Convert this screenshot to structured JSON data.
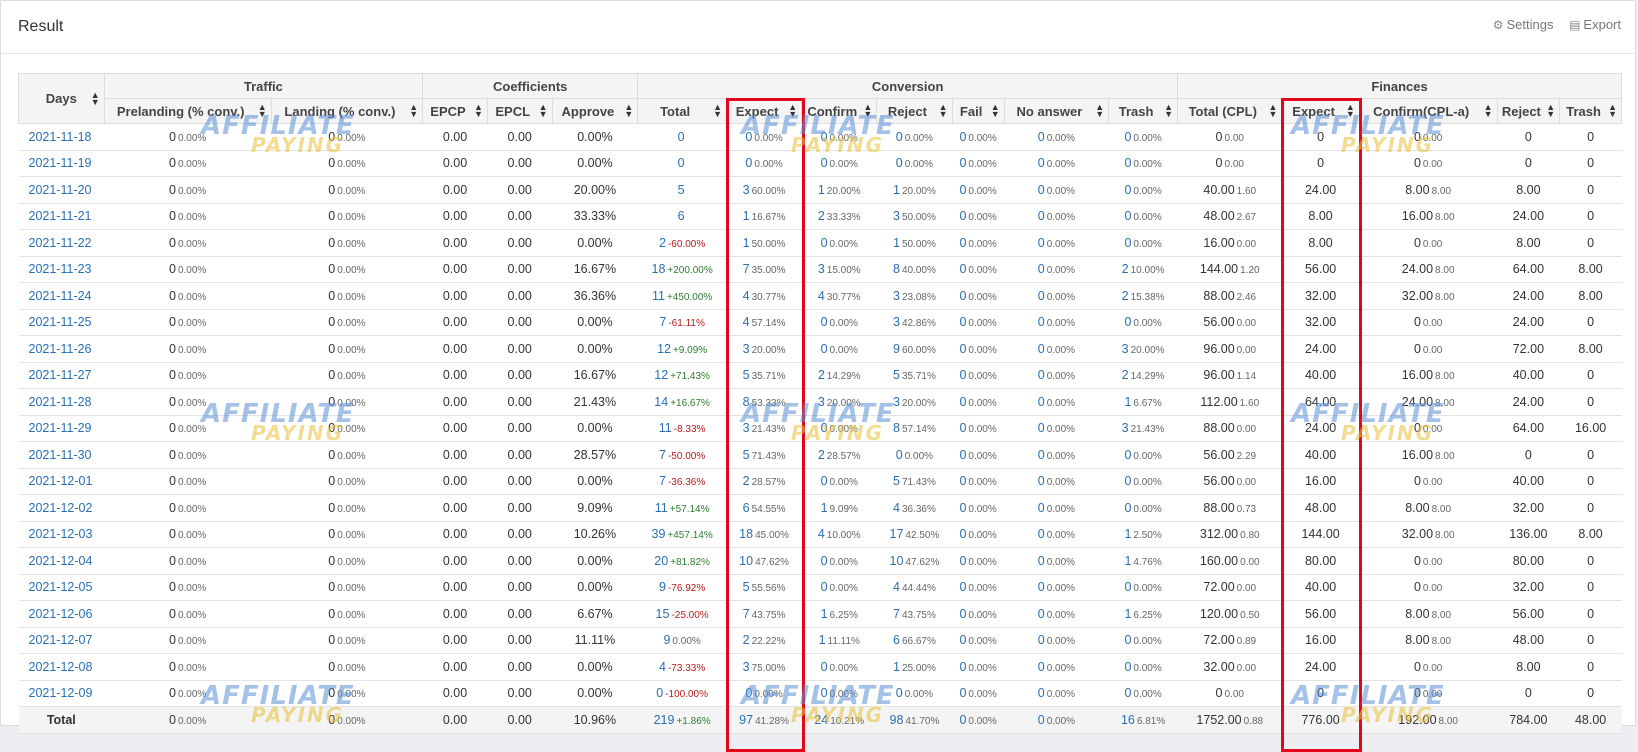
{
  "panel": {
    "title": "Result",
    "settings_label": "Settings",
    "export_label": "Export",
    "settings_icon": "gear-icon",
    "export_icon": "file-icon"
  },
  "watermark": {
    "line1": "AFFILIATE",
    "line2": "PAYING"
  },
  "headers": {
    "days": "Days",
    "groups": [
      "Traffic",
      "Coefficients",
      "Conversion",
      "Finances"
    ],
    "columns": [
      "Prelanding (% conv.)",
      "Landing (% conv.)",
      "EPCP",
      "EPCL",
      "Approve",
      "Total",
      "Expect",
      "Confirm",
      "Reject",
      "Fail",
      "No answer",
      "Trash",
      "Total (CPL)",
      "Expect",
      "Confirm(CPL-a)",
      "Reject",
      "Trash"
    ]
  },
  "rows": [
    {
      "date": "2021-11-18",
      "pre": "0",
      "pre_p": "0.00%",
      "land": "0",
      "land_p": "0.00%",
      "epcp": "0.00",
      "epcl": "0.00",
      "approve": "0.00%",
      "total": "0",
      "total_p": "",
      "total_s": "",
      "expect": "0",
      "expect_p": "0.00%",
      "confirm": "0",
      "confirm_p": "0.00%",
      "reject": "0",
      "reject_p": "0.00%",
      "fail": "0",
      "fail_p": "0.00%",
      "noans": "0",
      "noans_p": "0.00%",
      "trash": "0",
      "trash_p": "0.00%",
      "fcpl": "0",
      "fcpl_s": "0.00",
      "fexpect": "0",
      "fconfirm": "0",
      "fconfirm_s": "0.00",
      "freject": "0",
      "ftrash": "0"
    },
    {
      "date": "2021-11-19",
      "pre": "0",
      "pre_p": "0.00%",
      "land": "0",
      "land_p": "0.00%",
      "epcp": "0.00",
      "epcl": "0.00",
      "approve": "0.00%",
      "total": "0",
      "total_p": "",
      "total_s": "",
      "expect": "0",
      "expect_p": "0.00%",
      "confirm": "0",
      "confirm_p": "0.00%",
      "reject": "0",
      "reject_p": "0.00%",
      "fail": "0",
      "fail_p": "0.00%",
      "noans": "0",
      "noans_p": "0.00%",
      "trash": "0",
      "trash_p": "0.00%",
      "fcpl": "0",
      "fcpl_s": "0.00",
      "fexpect": "0",
      "fconfirm": "0",
      "fconfirm_s": "0.00",
      "freject": "0",
      "ftrash": "0"
    },
    {
      "date": "2021-11-20",
      "pre": "0",
      "pre_p": "0.00%",
      "land": "0",
      "land_p": "0.00%",
      "epcp": "0.00",
      "epcl": "0.00",
      "approve": "20.00%",
      "total": "5",
      "total_p": "",
      "total_s": "",
      "expect": "3",
      "expect_p": "60.00%",
      "confirm": "1",
      "confirm_p": "20.00%",
      "reject": "1",
      "reject_p": "20.00%",
      "fail": "0",
      "fail_p": "0.00%",
      "noans": "0",
      "noans_p": "0.00%",
      "trash": "0",
      "trash_p": "0.00%",
      "fcpl": "40.00",
      "fcpl_s": "1.60",
      "fexpect": "24.00",
      "fconfirm": "8.00",
      "fconfirm_s": "8.00",
      "freject": "8.00",
      "ftrash": "0"
    },
    {
      "date": "2021-11-21",
      "pre": "0",
      "pre_p": "0.00%",
      "land": "0",
      "land_p": "0.00%",
      "epcp": "0.00",
      "epcl": "0.00",
      "approve": "33.33%",
      "total": "6",
      "total_p": "",
      "total_s": "",
      "expect": "1",
      "expect_p": "16.67%",
      "confirm": "2",
      "confirm_p": "33.33%",
      "reject": "3",
      "reject_p": "50.00%",
      "fail": "0",
      "fail_p": "0.00%",
      "noans": "0",
      "noans_p": "0.00%",
      "trash": "0",
      "trash_p": "0.00%",
      "fcpl": "48.00",
      "fcpl_s": "2.67",
      "fexpect": "8.00",
      "fconfirm": "16.00",
      "fconfirm_s": "8.00",
      "freject": "24.00",
      "ftrash": "0"
    },
    {
      "date": "2021-11-22",
      "pre": "0",
      "pre_p": "0.00%",
      "land": "0",
      "land_p": "0.00%",
      "epcp": "0.00",
      "epcl": "0.00",
      "approve": "0.00%",
      "total": "2",
      "total_p": "-60.00%",
      "total_s": "neg",
      "expect": "1",
      "expect_p": "50.00%",
      "confirm": "0",
      "confirm_p": "0.00%",
      "reject": "1",
      "reject_p": "50.00%",
      "fail": "0",
      "fail_p": "0.00%",
      "noans": "0",
      "noans_p": "0.00%",
      "trash": "0",
      "trash_p": "0.00%",
      "fcpl": "16.00",
      "fcpl_s": "0.00",
      "fexpect": "8.00",
      "fconfirm": "0",
      "fconfirm_s": "0.00",
      "freject": "8.00",
      "ftrash": "0"
    },
    {
      "date": "2021-11-23",
      "pre": "0",
      "pre_p": "0.00%",
      "land": "0",
      "land_p": "0.00%",
      "epcp": "0.00",
      "epcl": "0.00",
      "approve": "16.67%",
      "total": "18",
      "total_p": "+200.00%",
      "total_s": "pos",
      "expect": "7",
      "expect_p": "35.00%",
      "confirm": "3",
      "confirm_p": "15.00%",
      "reject": "8",
      "reject_p": "40.00%",
      "fail": "0",
      "fail_p": "0.00%",
      "noans": "0",
      "noans_p": "0.00%",
      "trash": "2",
      "trash_p": "10.00%",
      "fcpl": "144.00",
      "fcpl_s": "1.20",
      "fexpect": "56.00",
      "fconfirm": "24.00",
      "fconfirm_s": "8.00",
      "freject": "64.00",
      "ftrash": "8.00"
    },
    {
      "date": "2021-11-24",
      "pre": "0",
      "pre_p": "0.00%",
      "land": "0",
      "land_p": "0.00%",
      "epcp": "0.00",
      "epcl": "0.00",
      "approve": "36.36%",
      "total": "11",
      "total_p": "+450.00%",
      "total_s": "pos",
      "expect": "4",
      "expect_p": "30.77%",
      "confirm": "4",
      "confirm_p": "30.77%",
      "reject": "3",
      "reject_p": "23.08%",
      "fail": "0",
      "fail_p": "0.00%",
      "noans": "0",
      "noans_p": "0.00%",
      "trash": "2",
      "trash_p": "15.38%",
      "fcpl": "88.00",
      "fcpl_s": "2.46",
      "fexpect": "32.00",
      "fconfirm": "32.00",
      "fconfirm_s": "8.00",
      "freject": "24.00",
      "ftrash": "8.00"
    },
    {
      "date": "2021-11-25",
      "pre": "0",
      "pre_p": "0.00%",
      "land": "0",
      "land_p": "0.00%",
      "epcp": "0.00",
      "epcl": "0.00",
      "approve": "0.00%",
      "total": "7",
      "total_p": "-61.11%",
      "total_s": "neg",
      "expect": "4",
      "expect_p": "57.14%",
      "confirm": "0",
      "confirm_p": "0.00%",
      "reject": "3",
      "reject_p": "42.86%",
      "fail": "0",
      "fail_p": "0.00%",
      "noans": "0",
      "noans_p": "0.00%",
      "trash": "0",
      "trash_p": "0.00%",
      "fcpl": "56.00",
      "fcpl_s": "0.00",
      "fexpect": "32.00",
      "fconfirm": "0",
      "fconfirm_s": "0.00",
      "freject": "24.00",
      "ftrash": "0"
    },
    {
      "date": "2021-11-26",
      "pre": "0",
      "pre_p": "0.00%",
      "land": "0",
      "land_p": "0.00%",
      "epcp": "0.00",
      "epcl": "0.00",
      "approve": "0.00%",
      "total": "12",
      "total_p": "+9.09%",
      "total_s": "pos",
      "expect": "3",
      "expect_p": "20.00%",
      "confirm": "0",
      "confirm_p": "0.00%",
      "reject": "9",
      "reject_p": "60.00%",
      "fail": "0",
      "fail_p": "0.00%",
      "noans": "0",
      "noans_p": "0.00%",
      "trash": "3",
      "trash_p": "20.00%",
      "fcpl": "96.00",
      "fcpl_s": "0.00",
      "fexpect": "24.00",
      "fconfirm": "0",
      "fconfirm_s": "0.00",
      "freject": "72.00",
      "ftrash": "8.00"
    },
    {
      "date": "2021-11-27",
      "pre": "0",
      "pre_p": "0.00%",
      "land": "0",
      "land_p": "0.00%",
      "epcp": "0.00",
      "epcl": "0.00",
      "approve": "16.67%",
      "total": "12",
      "total_p": "+71.43%",
      "total_s": "pos",
      "expect": "5",
      "expect_p": "35.71%",
      "confirm": "2",
      "confirm_p": "14.29%",
      "reject": "5",
      "reject_p": "35.71%",
      "fail": "0",
      "fail_p": "0.00%",
      "noans": "0",
      "noans_p": "0.00%",
      "trash": "2",
      "trash_p": "14.29%",
      "fcpl": "96.00",
      "fcpl_s": "1.14",
      "fexpect": "40.00",
      "fconfirm": "16.00",
      "fconfirm_s": "8.00",
      "freject": "40.00",
      "ftrash": "0"
    },
    {
      "date": "2021-11-28",
      "pre": "0",
      "pre_p": "0.00%",
      "land": "0",
      "land_p": "0.00%",
      "epcp": "0.00",
      "epcl": "0.00",
      "approve": "21.43%",
      "total": "14",
      "total_p": "+16.67%",
      "total_s": "pos",
      "expect": "8",
      "expect_p": "53.33%",
      "confirm": "3",
      "confirm_p": "20.00%",
      "reject": "3",
      "reject_p": "20.00%",
      "fail": "0",
      "fail_p": "0.00%",
      "noans": "0",
      "noans_p": "0.00%",
      "trash": "1",
      "trash_p": "6.67%",
      "fcpl": "112.00",
      "fcpl_s": "1.60",
      "fexpect": "64.00",
      "fconfirm": "24.00",
      "fconfirm_s": "8.00",
      "freject": "24.00",
      "ftrash": "0"
    },
    {
      "date": "2021-11-29",
      "pre": "0",
      "pre_p": "0.00%",
      "land": "0",
      "land_p": "0.00%",
      "epcp": "0.00",
      "epcl": "0.00",
      "approve": "0.00%",
      "total": "11",
      "total_p": "-8.33%",
      "total_s": "neg",
      "expect": "3",
      "expect_p": "21.43%",
      "confirm": "0",
      "confirm_p": "0.00%",
      "reject": "8",
      "reject_p": "57.14%",
      "fail": "0",
      "fail_p": "0.00%",
      "noans": "0",
      "noans_p": "0.00%",
      "trash": "3",
      "trash_p": "21.43%",
      "fcpl": "88.00",
      "fcpl_s": "0.00",
      "fexpect": "24.00",
      "fconfirm": "0",
      "fconfirm_s": "0.00",
      "freject": "64.00",
      "ftrash": "16.00"
    },
    {
      "date": "2021-11-30",
      "pre": "0",
      "pre_p": "0.00%",
      "land": "0",
      "land_p": "0.00%",
      "epcp": "0.00",
      "epcl": "0.00",
      "approve": "28.57%",
      "total": "7",
      "total_p": "-50.00%",
      "total_s": "neg",
      "expect": "5",
      "expect_p": "71.43%",
      "confirm": "2",
      "confirm_p": "28.57%",
      "reject": "0",
      "reject_p": "0.00%",
      "fail": "0",
      "fail_p": "0.00%",
      "noans": "0",
      "noans_p": "0.00%",
      "trash": "0",
      "trash_p": "0.00%",
      "fcpl": "56.00",
      "fcpl_s": "2.29",
      "fexpect": "40.00",
      "fconfirm": "16.00",
      "fconfirm_s": "8.00",
      "freject": "0",
      "ftrash": "0"
    },
    {
      "date": "2021-12-01",
      "pre": "0",
      "pre_p": "0.00%",
      "land": "0",
      "land_p": "0.00%",
      "epcp": "0.00",
      "epcl": "0.00",
      "approve": "0.00%",
      "total": "7",
      "total_p": "-36.36%",
      "total_s": "neg",
      "expect": "2",
      "expect_p": "28.57%",
      "confirm": "0",
      "confirm_p": "0.00%",
      "reject": "5",
      "reject_p": "71.43%",
      "fail": "0",
      "fail_p": "0.00%",
      "noans": "0",
      "noans_p": "0.00%",
      "trash": "0",
      "trash_p": "0.00%",
      "fcpl": "56.00",
      "fcpl_s": "0.00",
      "fexpect": "16.00",
      "fconfirm": "0",
      "fconfirm_s": "0.00",
      "freject": "40.00",
      "ftrash": "0"
    },
    {
      "date": "2021-12-02",
      "pre": "0",
      "pre_p": "0.00%",
      "land": "0",
      "land_p": "0.00%",
      "epcp": "0.00",
      "epcl": "0.00",
      "approve": "9.09%",
      "total": "11",
      "total_p": "+57.14%",
      "total_s": "pos",
      "expect": "6",
      "expect_p": "54.55%",
      "confirm": "1",
      "confirm_p": "9.09%",
      "reject": "4",
      "reject_p": "36.36%",
      "fail": "0",
      "fail_p": "0.00%",
      "noans": "0",
      "noans_p": "0.00%",
      "trash": "0",
      "trash_p": "0.00%",
      "fcpl": "88.00",
      "fcpl_s": "0.73",
      "fexpect": "48.00",
      "fconfirm": "8.00",
      "fconfirm_s": "8.00",
      "freject": "32.00",
      "ftrash": "0"
    },
    {
      "date": "2021-12-03",
      "pre": "0",
      "pre_p": "0.00%",
      "land": "0",
      "land_p": "0.00%",
      "epcp": "0.00",
      "epcl": "0.00",
      "approve": "10.26%",
      "total": "39",
      "total_p": "+457.14%",
      "total_s": "pos",
      "expect": "18",
      "expect_p": "45.00%",
      "confirm": "4",
      "confirm_p": "10.00%",
      "reject": "17",
      "reject_p": "42.50%",
      "fail": "0",
      "fail_p": "0.00%",
      "noans": "0",
      "noans_p": "0.00%",
      "trash": "1",
      "trash_p": "2.50%",
      "fcpl": "312.00",
      "fcpl_s": "0.80",
      "fexpect": "144.00",
      "fconfirm": "32.00",
      "fconfirm_s": "8.00",
      "freject": "136.00",
      "ftrash": "8.00"
    },
    {
      "date": "2021-12-04",
      "pre": "0",
      "pre_p": "0.00%",
      "land": "0",
      "land_p": "0.00%",
      "epcp": "0.00",
      "epcl": "0.00",
      "approve": "0.00%",
      "total": "20",
      "total_p": "+81.82%",
      "total_s": "pos",
      "expect": "10",
      "expect_p": "47.62%",
      "confirm": "0",
      "confirm_p": "0.00%",
      "reject": "10",
      "reject_p": "47.62%",
      "fail": "0",
      "fail_p": "0.00%",
      "noans": "0",
      "noans_p": "0.00%",
      "trash": "1",
      "trash_p": "4.76%",
      "fcpl": "160.00",
      "fcpl_s": "0.00",
      "fexpect": "80.00",
      "fconfirm": "0",
      "fconfirm_s": "0.00",
      "freject": "80.00",
      "ftrash": "0"
    },
    {
      "date": "2021-12-05",
      "pre": "0",
      "pre_p": "0.00%",
      "land": "0",
      "land_p": "0.00%",
      "epcp": "0.00",
      "epcl": "0.00",
      "approve": "0.00%",
      "total": "9",
      "total_p": "-76.92%",
      "total_s": "neg",
      "expect": "5",
      "expect_p": "55.56%",
      "confirm": "0",
      "confirm_p": "0.00%",
      "reject": "4",
      "reject_p": "44.44%",
      "fail": "0",
      "fail_p": "0.00%",
      "noans": "0",
      "noans_p": "0.00%",
      "trash": "0",
      "trash_p": "0.00%",
      "fcpl": "72.00",
      "fcpl_s": "0.00",
      "fexpect": "40.00",
      "fconfirm": "0",
      "fconfirm_s": "0.00",
      "freject": "32.00",
      "ftrash": "0"
    },
    {
      "date": "2021-12-06",
      "pre": "0",
      "pre_p": "0.00%",
      "land": "0",
      "land_p": "0.00%",
      "epcp": "0.00",
      "epcl": "0.00",
      "approve": "6.67%",
      "total": "15",
      "total_p": "-25.00%",
      "total_s": "neg",
      "expect": "7",
      "expect_p": "43.75%",
      "confirm": "1",
      "confirm_p": "6.25%",
      "reject": "7",
      "reject_p": "43.75%",
      "fail": "0",
      "fail_p": "0.00%",
      "noans": "0",
      "noans_p": "0.00%",
      "trash": "1",
      "trash_p": "6.25%",
      "fcpl": "120.00",
      "fcpl_s": "0.50",
      "fexpect": "56.00",
      "fconfirm": "8.00",
      "fconfirm_s": "8.00",
      "freject": "56.00",
      "ftrash": "0"
    },
    {
      "date": "2021-12-07",
      "pre": "0",
      "pre_p": "0.00%",
      "land": "0",
      "land_p": "0.00%",
      "epcp": "0.00",
      "epcl": "0.00",
      "approve": "11.11%",
      "total": "9",
      "total_p": "0.00%",
      "total_s": "small",
      "expect": "2",
      "expect_p": "22.22%",
      "confirm": "1",
      "confirm_p": "11.11%",
      "reject": "6",
      "reject_p": "66.67%",
      "fail": "0",
      "fail_p": "0.00%",
      "noans": "0",
      "noans_p": "0.00%",
      "trash": "0",
      "trash_p": "0.00%",
      "fcpl": "72.00",
      "fcpl_s": "0.89",
      "fexpect": "16.00",
      "fconfirm": "8.00",
      "fconfirm_s": "8.00",
      "freject": "48.00",
      "ftrash": "0"
    },
    {
      "date": "2021-12-08",
      "pre": "0",
      "pre_p": "0.00%",
      "land": "0",
      "land_p": "0.00%",
      "epcp": "0.00",
      "epcl": "0.00",
      "approve": "0.00%",
      "total": "4",
      "total_p": "-73.33%",
      "total_s": "neg",
      "expect": "3",
      "expect_p": "75.00%",
      "confirm": "0",
      "confirm_p": "0.00%",
      "reject": "1",
      "reject_p": "25.00%",
      "fail": "0",
      "fail_p": "0.00%",
      "noans": "0",
      "noans_p": "0.00%",
      "trash": "0",
      "trash_p": "0.00%",
      "fcpl": "32.00",
      "fcpl_s": "0.00",
      "fexpect": "24.00",
      "fconfirm": "0",
      "fconfirm_s": "0.00",
      "freject": "8.00",
      "ftrash": "0"
    },
    {
      "date": "2021-12-09",
      "pre": "0",
      "pre_p": "0.00%",
      "land": "0",
      "land_p": "0.00%",
      "epcp": "0.00",
      "epcl": "0.00",
      "approve": "0.00%",
      "total": "0",
      "total_p": "-100.00%",
      "total_s": "neg",
      "expect": "0",
      "expect_p": "0.00%",
      "confirm": "0",
      "confirm_p": "0.00%",
      "reject": "0",
      "reject_p": "0.00%",
      "fail": "0",
      "fail_p": "0.00%",
      "noans": "0",
      "noans_p": "0.00%",
      "trash": "0",
      "trash_p": "0.00%",
      "fcpl": "0",
      "fcpl_s": "0.00",
      "fexpect": "0",
      "fconfirm": "0",
      "fconfirm_s": "0.00",
      "freject": "0",
      "ftrash": "0"
    }
  ],
  "total": {
    "label": "Total",
    "pre": "0",
    "pre_p": "0.00%",
    "land": "0",
    "land_p": "0.00%",
    "epcp": "0.00",
    "epcl": "0.00",
    "approve": "10.96%",
    "total": "219",
    "total_p": "+1.86%",
    "total_s": "pos",
    "expect": "97",
    "expect_p": "41.28%",
    "confirm": "24",
    "confirm_p": "10.21%",
    "reject": "98",
    "reject_p": "41.70%",
    "fail": "0",
    "fail_p": "0.00%",
    "noans": "0",
    "noans_p": "0.00%",
    "trash": "16",
    "trash_p": "6.81%",
    "fcpl": "1752.00",
    "fcpl_s": "0.88",
    "fexpect": "776.00",
    "fconfirm": "192.00",
    "fconfirm_s": "8.00",
    "freject": "784.00",
    "ftrash": "48.00"
  },
  "highlight_color": "#e3061b"
}
